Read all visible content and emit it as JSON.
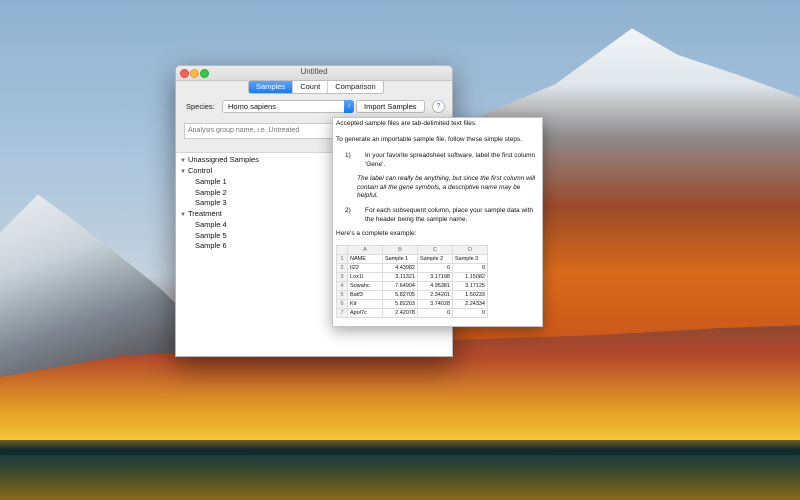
{
  "window": {
    "title": "Untitled",
    "tabs": [
      "Samples",
      "Count",
      "Comparison"
    ],
    "active_tab": "Samples",
    "species_label": "Species:",
    "species_value": "Homo sapiens",
    "import_button": "Import Samples",
    "help_button": "?",
    "group_placeholder": "Analysis group name, i.e. Untreated"
  },
  "tree": {
    "unassigned": "Unassigned Samples",
    "groups": [
      {
        "label": "Control",
        "samples": [
          "Sample 1",
          "Sample 2",
          "Sample 3"
        ]
      },
      {
        "label": "Treatment",
        "samples": [
          "Sample 4",
          "Sample 5",
          "Sample 6"
        ]
      }
    ]
  },
  "help": {
    "line1": "Accepted sample files are tab-delimited text files.",
    "line2": "To generate an importable sample file, follow these simple steps.",
    "step1_num": "1)",
    "step1_text": "In your favorite spreadsheet software, label the first column 'Gene'.",
    "step1_note": "The label can really be anything, but since the first column will contain all the gene symbols, a descriptive name may be helpful.",
    "step2_num": "2)",
    "step2_text": "For each subsequent column, place your sample data with the header being the sample name.",
    "example_label": "Here's a complete example:",
    "sheet": {
      "col_headers": [
        "A",
        "B",
        "C",
        "D"
      ],
      "rows": [
        [
          "NAME",
          "Sample 1",
          "Sample 2",
          "Sample 3"
        ],
        [
          "Il22",
          "4.43982",
          "0",
          "0"
        ],
        [
          "Lox1l",
          "3.11321",
          "3.17198",
          "1.15082"
        ],
        [
          "Sowahc",
          "7.64904",
          "4.95381",
          "3.17125"
        ],
        [
          "Batf3",
          "5.82705",
          "2.34201",
          "1.50233"
        ],
        [
          "Kit",
          "5.82203",
          "3.74028",
          "2.24334"
        ],
        [
          "Apol7c",
          "2.42078",
          "0",
          "0"
        ]
      ]
    }
  }
}
